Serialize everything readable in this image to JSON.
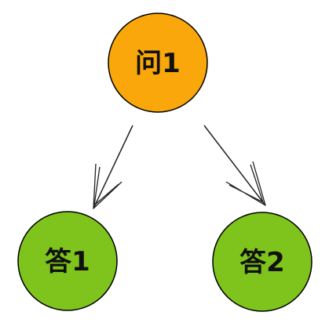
{
  "nodes": {
    "question": {
      "label": "问1",
      "color": "#f9a70a"
    },
    "answer1": {
      "label": "答1",
      "color": "#7ec41c"
    },
    "answer2": {
      "label": "答2",
      "color": "#7ec41c"
    }
  },
  "edge_color": "#222222",
  "node_stroke_color": "#000000"
}
